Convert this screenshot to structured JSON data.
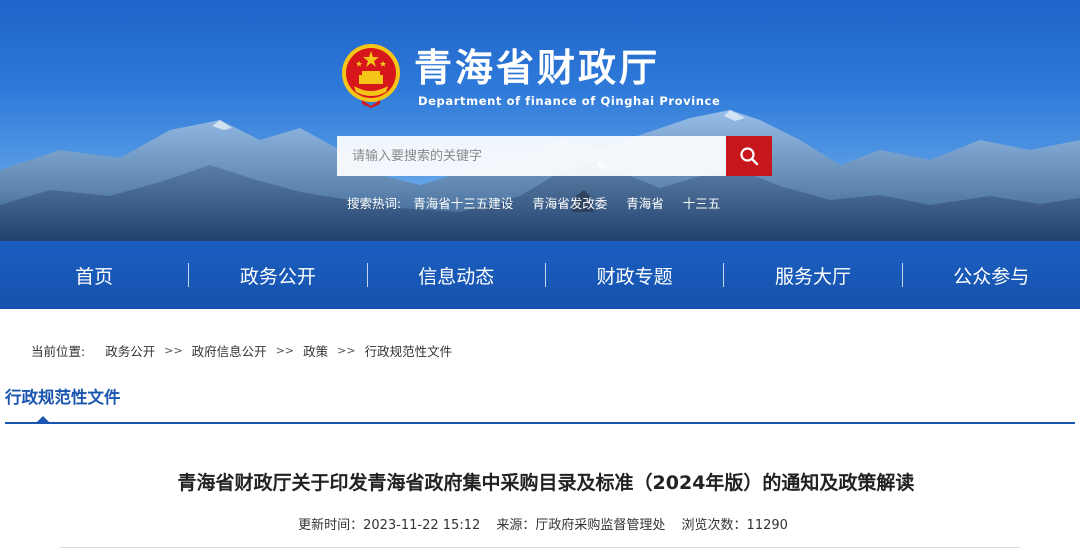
{
  "header": {
    "title": "青海省财政厅",
    "subtitle": "Department of finance of Qinghai Province",
    "emblem_icon": "national-emblem-icon"
  },
  "search": {
    "placeholder": "请输入要搜索的关键字",
    "button_icon": "search-icon",
    "hot_label": "搜索热词:",
    "hot_terms": [
      "青海省十三五建设",
      "青海省发改委",
      "青海省",
      "十三五"
    ]
  },
  "nav": {
    "items": [
      "首页",
      "政务公开",
      "信息动态",
      "财政专题",
      "服务大厅",
      "公众参与"
    ]
  },
  "breadcrumb": {
    "label": "当前位置:",
    "items": [
      "政务公开",
      "政府信息公开",
      "政策",
      "行政规范性文件"
    ],
    "separator": ">>"
  },
  "section": {
    "title": "行政规范性文件"
  },
  "article": {
    "title": "青海省财政厅关于印发青海省政府集中采购目录及标准（2024年版）的通知及政策解读",
    "updated": "更新时间：2023-11-22 15:12",
    "source": "来源：厅政府采购监督管理处",
    "views": "浏览次数：11290"
  },
  "colors": {
    "primary_blue": "#1a56b0",
    "nav_blue": "#1b5fc1",
    "search_red": "#c8161d",
    "emblem_red": "#d7161c",
    "emblem_gold": "#f5c518"
  }
}
